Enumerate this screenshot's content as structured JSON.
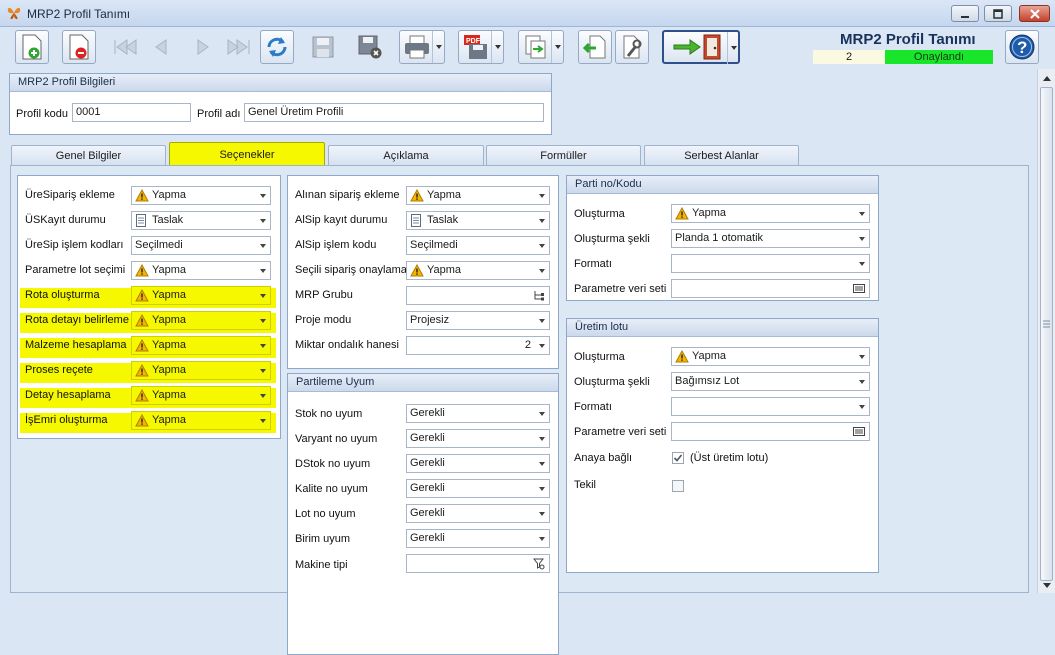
{
  "window": {
    "title": "MRP2 Profil Tanımı"
  },
  "header": {
    "form_title": "MRP2 Profil Tanımı",
    "status_number": "2",
    "status_text": "Onaylandı",
    "status_color": "#19e62b"
  },
  "toolbar": {
    "buttons": [
      {
        "icon": "new-document-icon"
      },
      {
        "icon": "delete-document-icon"
      },
      {
        "icon": "first-record-icon"
      },
      {
        "icon": "previous-record-icon"
      },
      {
        "icon": "next-record-icon"
      },
      {
        "icon": "last-record-icon"
      },
      {
        "icon": "refresh-icon"
      },
      {
        "icon": "save-icon"
      },
      {
        "icon": "save-close-icon"
      },
      {
        "icon": "print-icon"
      },
      {
        "icon": "pdf-save-icon"
      },
      {
        "icon": "export-icon"
      },
      {
        "icon": "import-icon"
      },
      {
        "icon": "tools-icon"
      },
      {
        "icon": "exit-door-icon"
      },
      {
        "icon": "help-icon"
      }
    ]
  },
  "profile_info": {
    "title": "MRP2 Profil Bilgileri",
    "code_label": "Profil kodu",
    "code_value": "0001",
    "name_label": "Profil adı",
    "name_value": "Genel Üretim Profili"
  },
  "tabs": [
    {
      "label": "Genel Bilgiler"
    },
    {
      "label": "Seçenekler"
    },
    {
      "label": "Açıklama"
    },
    {
      "label": "Formüller"
    },
    {
      "label": "Serbest Alanlar"
    }
  ],
  "left_panel": {
    "rows": [
      {
        "label": "ÜreSipariş ekleme",
        "value": "Yapma",
        "icon": "warning-icon"
      },
      {
        "label": "ÜSKayıt durumu",
        "value": "Taslak",
        "icon": "document-icon"
      },
      {
        "label": "ÜreSip işlem kodları",
        "value": "Seçilmedi",
        "icon": ""
      },
      {
        "label": "Parametre lot seçimi",
        "value": "Yapma",
        "icon": "warning-icon"
      },
      {
        "label": "Rota oluşturma",
        "value": "Yapma",
        "icon": "warning-icon"
      },
      {
        "label": "Rota detayı belirleme",
        "value": "Yapma",
        "icon": "warning-icon"
      },
      {
        "label": "Malzeme hesaplama",
        "value": "Yapma",
        "icon": "warning-icon"
      },
      {
        "label": "Proses reçete",
        "value": "Yapma",
        "icon": "warning-icon"
      },
      {
        "label": "Detay hesaplama",
        "value": "Yapma",
        "icon": "warning-icon"
      },
      {
        "label": "İşEmri oluşturma",
        "value": "Yapma",
        "icon": "warning-icon"
      }
    ],
    "highlight_color": "#f6f800"
  },
  "middle_panel": {
    "rows": [
      {
        "label": "Alınan sipariş ekleme",
        "value": "Yapma",
        "icon": "warning-icon"
      },
      {
        "label": "AlSip kayıt durumu",
        "value": "Taslak",
        "icon": "document-icon"
      },
      {
        "label": "AlSip işlem kodu",
        "value": "Seçilmedi",
        "icon": ""
      },
      {
        "label": "Seçili sipariş onaylama",
        "value": "Yapma",
        "icon": "warning-icon"
      },
      {
        "label": "MRP Grubu",
        "value": "",
        "icon": ""
      },
      {
        "label": "Proje modu",
        "value": "Projesiz",
        "icon": ""
      },
      {
        "label": "Miktar ondalık hanesi",
        "value": "2",
        "icon": ""
      }
    ]
  },
  "partition": {
    "title": "Partileme Uyum",
    "rows": [
      {
        "label": "Stok no uyum",
        "value": "Gerekli"
      },
      {
        "label": "Varyant no uyum",
        "value": "Gerekli"
      },
      {
        "label": "DStok no uyum",
        "value": "Gerekli"
      },
      {
        "label": "Kalite no uyum",
        "value": "Gerekli"
      },
      {
        "label": "Lot no uyum",
        "value": "Gerekli"
      },
      {
        "label": "Birim uyum",
        "value": "Gerekli"
      },
      {
        "label": "Makine tipi",
        "value": ""
      }
    ]
  },
  "batch": {
    "title": "Parti no/Kodu",
    "rows": [
      {
        "label": "Oluşturma",
        "value": "Yapma",
        "icon": "warning-icon"
      },
      {
        "label": "Oluşturma şekli",
        "value": "Planda 1 otomatik",
        "icon": ""
      },
      {
        "label": "Formatı",
        "value": "",
        "icon": ""
      },
      {
        "label": "Parametre veri seti",
        "value": "",
        "icon": ""
      }
    ]
  },
  "production_lot": {
    "title": "Üretim lotu",
    "rows": [
      {
        "label": "Oluşturma",
        "value": "Yapma",
        "icon": "warning-icon"
      },
      {
        "label": "Oluşturma şekli",
        "value": "Bağımsız Lot",
        "icon": ""
      },
      {
        "label": "Formatı",
        "value": "",
        "icon": ""
      },
      {
        "label": "Parametre veri seti",
        "value": "",
        "icon": ""
      }
    ],
    "parent_label": "Anaya bağlı",
    "parent_checked": true,
    "parent_note": "(Üst üretim lotu)",
    "single_label": "Tekil",
    "single_checked": false
  }
}
